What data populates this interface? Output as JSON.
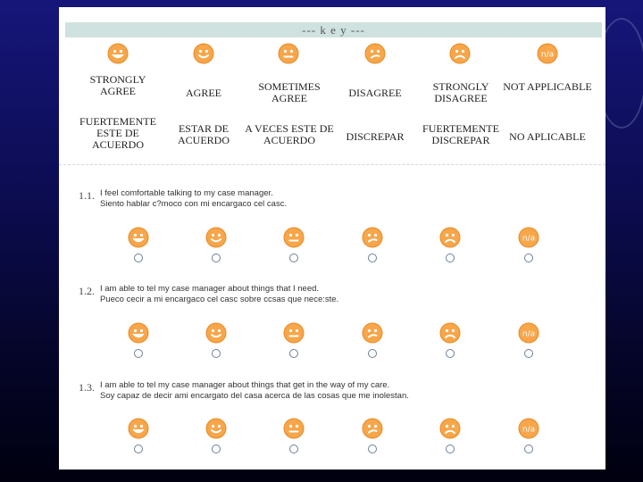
{
  "key": {
    "title": "--- k e y ---",
    "columns": [
      {
        "icon": "strongly-agree-face-icon",
        "en": "STRONGLY AGREE",
        "es": "FUERTEMENTE ESTE DE ACUERDO"
      },
      {
        "icon": "agree-face-icon",
        "en": "AGREE",
        "es": "ESTAR DE ACUERDO"
      },
      {
        "icon": "sometimes-agree-face-icon",
        "en": "SOMETIMES AGREE",
        "es": "A VECES ESTE DE ACUERDO"
      },
      {
        "icon": "disagree-face-icon",
        "en": "DISAGREE",
        "es": "DISCREPAR"
      },
      {
        "icon": "strongly-disagree-face-icon",
        "en": "STRONGLY DISAGREE",
        "es": "FUERTEMENTE DISCREPAR"
      },
      {
        "icon": "not-applicable-icon",
        "en": "NOT APPLICABLE",
        "es": "NO APLICABLE"
      }
    ]
  },
  "questions": [
    {
      "number": "1.1.",
      "en": "I feel comfortable talking to my case manager.",
      "es": "Siento hablar c?moco con mi encargaco cel casc."
    },
    {
      "number": "1.2.",
      "en": "I am able to tel my case manager about things that I need.",
      "es": "Pueco cecir a mi encargaco cel casc sobre ccsas que nece:ste."
    },
    {
      "number": "1.3.",
      "en": "I am able to tel my case manager about things that get in the way of my care.",
      "es": "Soy capaz de decir ami encargato del casa acerca de las cosas que me inolestan."
    }
  ],
  "colors": {
    "face_fill": "#f7a64a",
    "face_stroke": "#e98a24",
    "key_bar": "#cfe2df",
    "radio_border": "#6d7f9b"
  }
}
